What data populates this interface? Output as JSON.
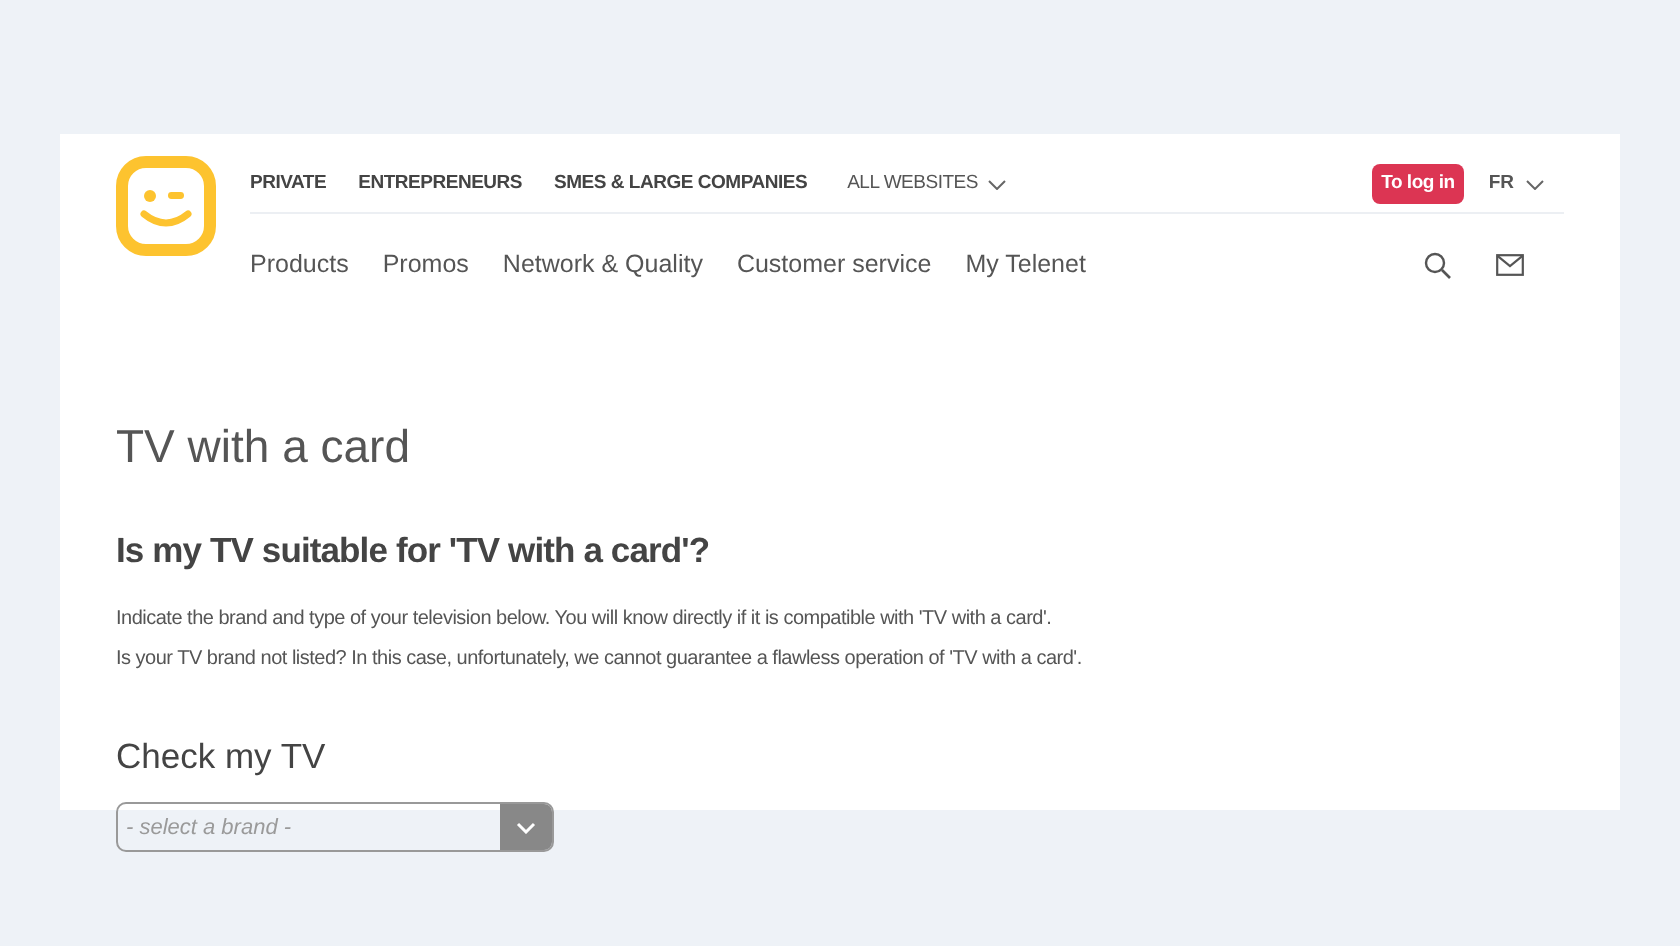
{
  "top_links": [
    "PRIVATE",
    "ENTREPRENEURS",
    "SMES & LARGE COMPANIES"
  ],
  "all_websites": "ALL WEBSITES",
  "login_button": "To log in",
  "language": "FR",
  "main_nav": [
    "Products",
    "Promos",
    "Network & Quality",
    "Customer service",
    "My Telenet"
  ],
  "page_title": "TV with a card",
  "heading": "Is my TV suitable for 'TV with a card'?",
  "paragraphs": [
    "Indicate the brand and type of your television below. You will know directly if it is compatible with 'TV with a card'.",
    "Is your TV brand not listed? In this case, unfortunately, we cannot guarantee a flawless operation of 'TV with a card'."
  ],
  "check_heading": "Check my TV",
  "brand_select": {
    "placeholder": "- select a brand -"
  }
}
